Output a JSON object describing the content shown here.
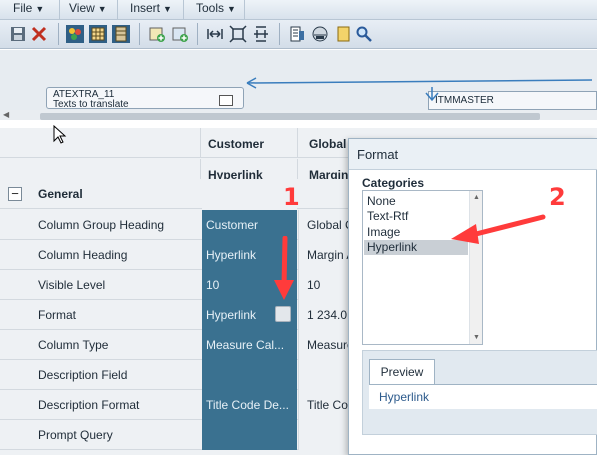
{
  "menu": [
    {
      "label": "File"
    },
    {
      "label": "View"
    },
    {
      "label": "Insert"
    },
    {
      "label": "Tools"
    }
  ],
  "toolbar_icons": [
    "save-icon",
    "delete-icon",
    "palette-icon",
    "grid-icon",
    "grid-alt-icon",
    "add-table-icon",
    "add-table-alt-icon",
    "fit-width-icon",
    "fit-page-icon",
    "fit-height-icon",
    "properties-icon",
    "preview-icon",
    "note-icon",
    "search-icon"
  ],
  "diagram": {
    "node_a_title": "ATEXTRA_11",
    "node_a_sub": "Texts to translate",
    "node_b_title": "ITMMASTER"
  },
  "grid": {
    "header_row1": {
      "col1": "Customer",
      "col2": "Global"
    },
    "header_row2": {
      "col1": "Hyperlink",
      "col2": "Margin"
    },
    "group": "General",
    "rows": [
      {
        "label": "Column Group Heading",
        "col1": "Customer",
        "col2": "Global C"
      },
      {
        "label": "Column Heading",
        "col1": "Hyperlink",
        "col2": "Margin A"
      },
      {
        "label": "Visible Level",
        "col1": "10",
        "col2": "10"
      },
      {
        "label": "Format",
        "col1": "Hyperlink",
        "col2": "1 234.0"
      },
      {
        "label": "Column Type",
        "col1": "Measure Cal...",
        "col2": "Measure"
      },
      {
        "label": "Description Field",
        "col1": "",
        "col2": ""
      },
      {
        "label": "Description Format",
        "col1": "Title Code De...",
        "col2": "Title Co"
      },
      {
        "label": "Prompt Query",
        "col1": "",
        "col2": ""
      }
    ]
  },
  "dialog": {
    "title": "Format",
    "categories_label": "Categories",
    "categories": [
      "None",
      "Text-Rtf",
      "Image",
      "Hyperlink"
    ],
    "selected": "Hyperlink",
    "preview_tab": "Preview",
    "preview_value": "Hyperlink"
  },
  "annotations": {
    "one": "1",
    "two": "2"
  },
  "colors": {
    "highlight_column": "#3a7190",
    "arrow": "#ff3b3b",
    "accent": "#1f5fa8"
  }
}
